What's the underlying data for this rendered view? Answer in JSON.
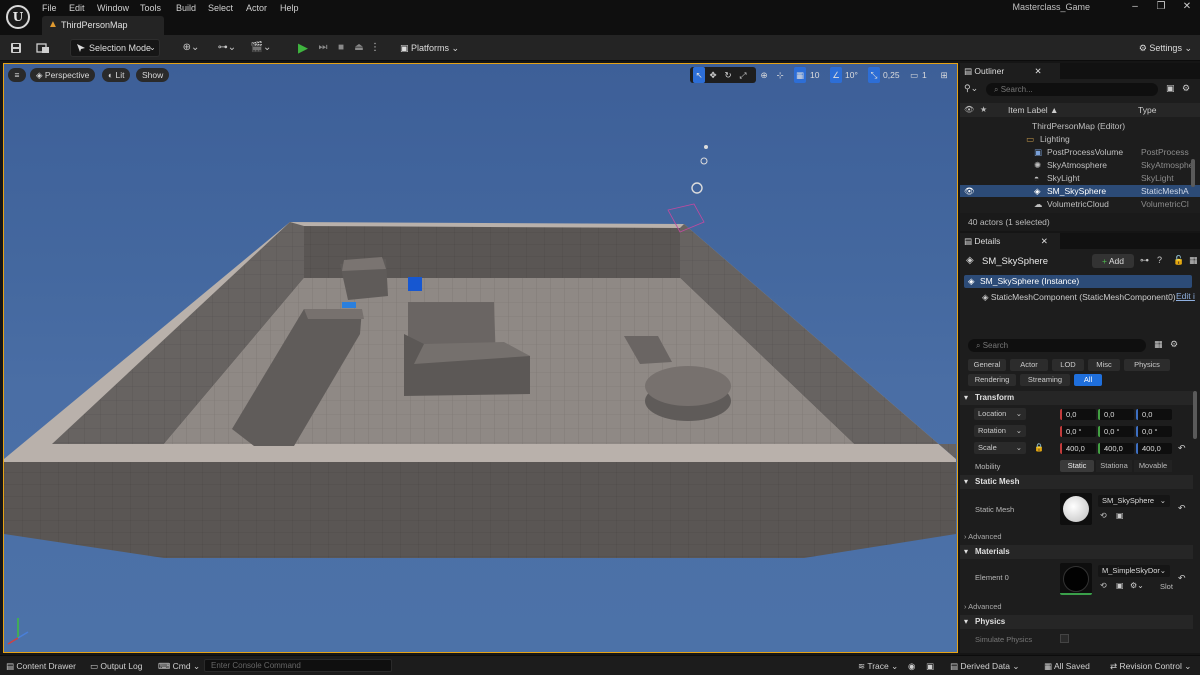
{
  "app": {
    "logo_label": "U",
    "menu": [
      "File",
      "Edit",
      "Window",
      "Tools",
      "Build",
      "Select",
      "Actor",
      "Help"
    ],
    "project_name": "Masterclass_Game",
    "level_tab": "ThirdPersonMap"
  },
  "toolbar": {
    "selection_mode": "Selection Mode",
    "platforms": "Platforms",
    "settings": "Settings"
  },
  "viewport": {
    "perspective": "Perspective",
    "lit": "Lit",
    "show": "Show",
    "grid_snap": "10",
    "rotation_snap": "10°",
    "scale_snap": "0,25",
    "camera_speed": "1"
  },
  "outliner": {
    "title": "Outliner",
    "search_placeholder": "Search...",
    "col_label": "Item Label ▲",
    "col_type": "Type",
    "rows": [
      {
        "label": "ThirdPersonMap (Editor)",
        "type": "",
        "indent": 0
      },
      {
        "label": "Lighting",
        "type": "",
        "indent": 1
      },
      {
        "label": "PostProcessVolume",
        "type": "PostProcess",
        "indent": 2
      },
      {
        "label": "SkyAtmosphere",
        "type": "SkyAtmosphe",
        "indent": 2
      },
      {
        "label": "SkyLight",
        "type": "SkyLight",
        "indent": 2
      },
      {
        "label": "SM_SkySphere",
        "type": "StaticMeshA",
        "indent": 2
      },
      {
        "label": "VolumetricCloud",
        "type": "VolumetricCl",
        "indent": 2
      }
    ],
    "footer": "40 actors (1 selected)"
  },
  "details": {
    "title": "Details",
    "actor_name": "SM_SkySphere",
    "add_label": "Add",
    "instance_label": "SM_SkySphere (Instance)",
    "component_label": "StaticMeshComponent (StaticMeshComponent0)",
    "edit_label": "Edit i",
    "search_placeholder": "Search",
    "tabs_row1": [
      "General",
      "Actor",
      "LOD",
      "Misc",
      "Physics"
    ],
    "tabs_row2": [
      "Rendering",
      "Streaming",
      "All"
    ],
    "transform": {
      "title": "Transform",
      "location_label": "Location",
      "rotation_label": "Rotation",
      "scale_label": "Scale",
      "location": [
        "0,0",
        "0,0",
        "0,0"
      ],
      "rotation": [
        "0,0 °",
        "0,0 °",
        "0,0 °"
      ],
      "scale": [
        "400,0",
        "400,0",
        "400,0"
      ],
      "mobility_label": "Mobility",
      "mobility_options": [
        "Static",
        "Stationa",
        "Movable"
      ]
    },
    "static_mesh": {
      "title": "Static Mesh",
      "label": "Static Mesh",
      "value": "SM_SkySphere",
      "advanced": "Advanced"
    },
    "materials": {
      "title": "Materials",
      "element_label": "Element 0",
      "value": "M_SimpleSkyDor",
      "slot_label": "Slot",
      "advanced": "Advanced"
    },
    "physics": {
      "title": "Physics",
      "simulate_label": "Simulate Physics"
    }
  },
  "statusbar": {
    "content_drawer": "Content Drawer",
    "output_log": "Output Log",
    "cmd": "Cmd",
    "console_placeholder": "Enter Console Command",
    "trace": "Trace",
    "derived_data": "Derived Data",
    "all_saved": "All Saved",
    "revision_control": "Revision Control"
  },
  "colors": {
    "accent_orange": "#e6a316",
    "selection_blue": "#2c4b77",
    "play_green": "#3fb43f",
    "sky_blue": "#4a6ea5"
  }
}
